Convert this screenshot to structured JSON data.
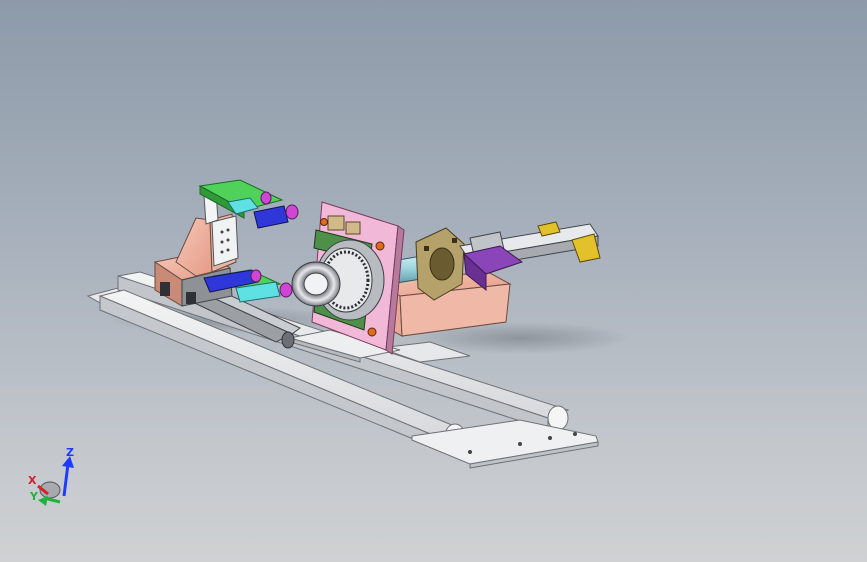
{
  "view": {
    "background_top": "#8d9aa9",
    "background_bottom": "#cfd1d3"
  },
  "triad": {
    "x_label": "X",
    "y_label": "Y",
    "z_label": "Z",
    "x_color": "#d4202a",
    "y_color": "#1fb33a",
    "z_color": "#1e3cff"
  }
}
